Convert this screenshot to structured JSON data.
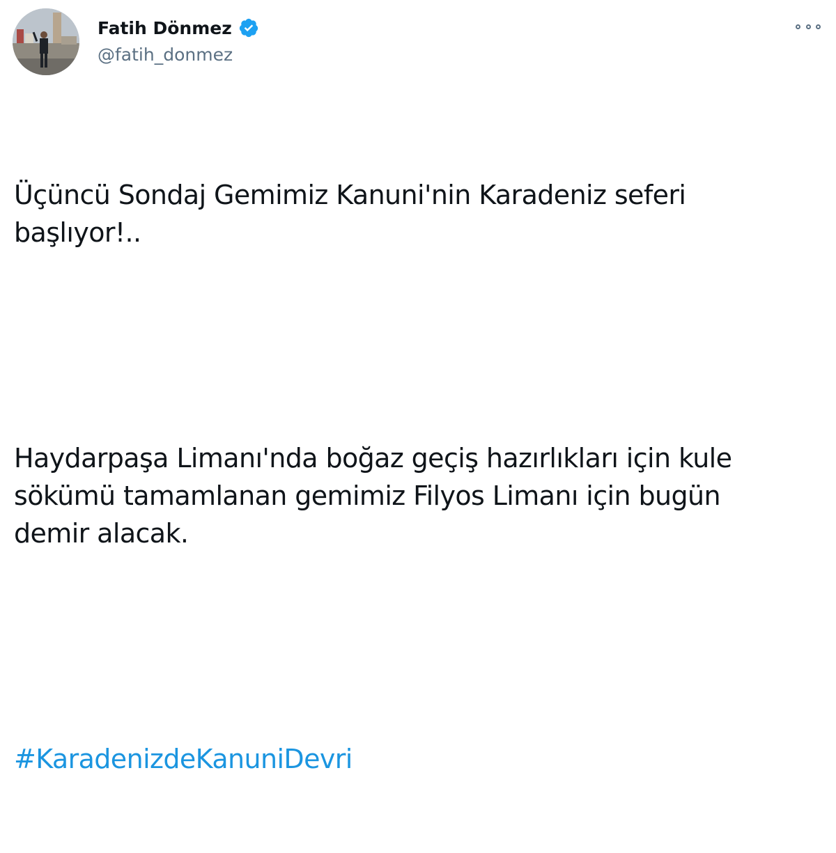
{
  "author": {
    "display_name": "Fatih Dönmez",
    "handle": "@fatih_donmez",
    "verified": true
  },
  "tweet": {
    "paragraphs": [
      "Üçüncü Sondaj Gemimiz Kanuni'nin Karadeniz seferi\nbaşlıyor!..",
      "Haydarpaşa Limanı'nda boğaz geçiş hazırlıkları için kule\nsökümü tamamlanan gemimiz Filyos Limanı için bugün\ndemir alacak."
    ],
    "hashtag": "#KaradenizdeKanuniDevri"
  },
  "icons": {
    "verified": "verified-badge-icon",
    "more": "more-options-icon"
  },
  "colors": {
    "link": "#1b95e0",
    "verified": "#1da1f2",
    "secondary_text": "#5b7083",
    "primary_text": "#0f1419"
  }
}
